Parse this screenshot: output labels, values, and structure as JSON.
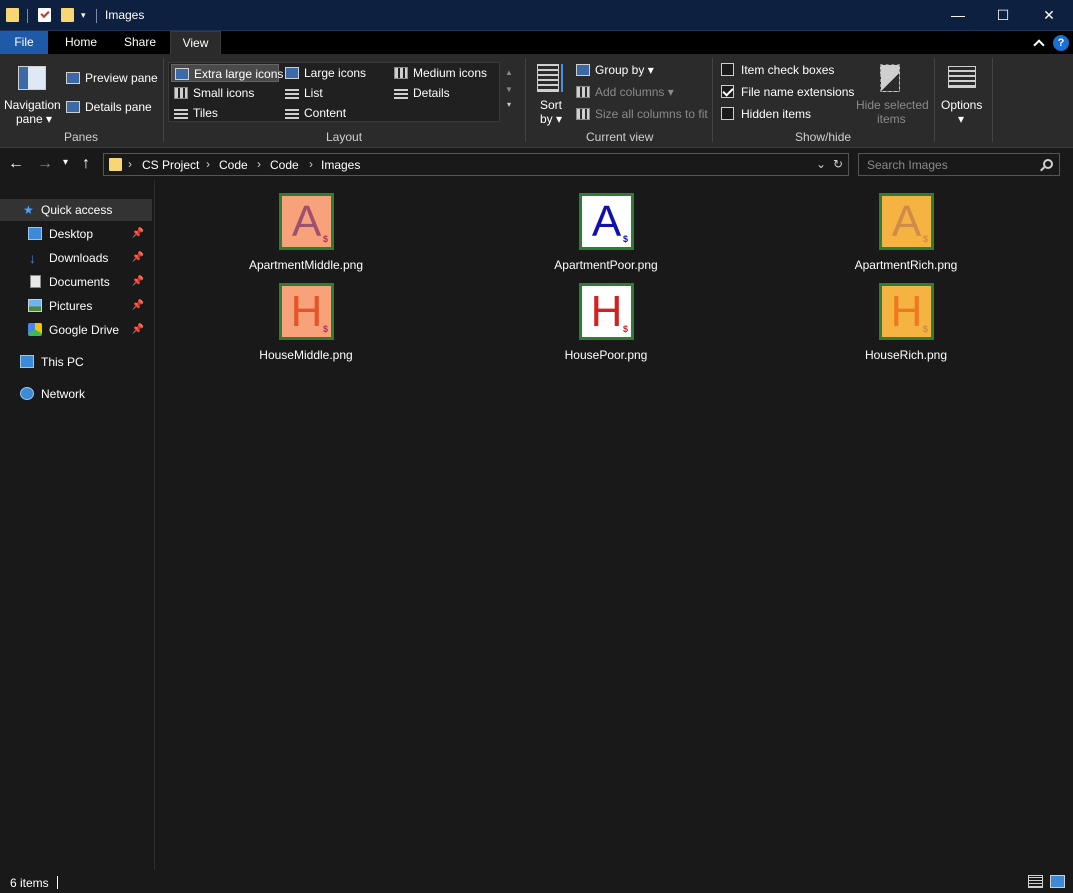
{
  "window": {
    "title": "Images"
  },
  "window_controls": {
    "minimize": "—",
    "maximize": "☐",
    "close": "✕"
  },
  "ribbon_tabs": [
    {
      "label": "File"
    },
    {
      "label": "Home"
    },
    {
      "label": "Share"
    },
    {
      "label": "View"
    }
  ],
  "help": {
    "label": "?"
  },
  "panes": {
    "navigation_pane": "Navigation",
    "navigation_pane_line2": "pane",
    "preview_pane": "Preview pane",
    "details_pane": "Details pane",
    "group_label": "Panes"
  },
  "layout": {
    "options": [
      {
        "label": "Extra large icons",
        "selected": true
      },
      {
        "label": "Large icons"
      },
      {
        "label": "Medium icons"
      },
      {
        "label": "Small icons"
      },
      {
        "label": "List"
      },
      {
        "label": "Details"
      },
      {
        "label": "Tiles"
      },
      {
        "label": "Content"
      }
    ],
    "group_label": "Layout"
  },
  "current_view": {
    "sort_by": "Sort",
    "sort_by_line2": "by",
    "group_by": "Group by",
    "add_columns": "Add columns",
    "size_columns": "Size all columns to fit",
    "group_label": "Current view"
  },
  "show_hide": {
    "item_check_boxes": {
      "label": "Item check boxes",
      "checked": false
    },
    "file_name_extensions": {
      "label": "File name extensions",
      "checked": true
    },
    "hidden_items": {
      "label": "Hidden items",
      "checked": false
    },
    "hide_selected": "Hide selected",
    "hide_selected_line2": "items",
    "group_label": "Show/hide"
  },
  "options": {
    "label": "Options"
  },
  "address": {
    "breadcrumbs": [
      "CS Project",
      "Code",
      "Code",
      "Images"
    ],
    "search_placeholder": "Search Images"
  },
  "nav_pane": {
    "quick_access": "Quick access",
    "items": [
      {
        "label": "Desktop",
        "pinned": true
      },
      {
        "label": "Downloads",
        "pinned": true
      },
      {
        "label": "Documents",
        "pinned": true
      },
      {
        "label": "Pictures",
        "pinned": true
      },
      {
        "label": "Google Drive",
        "pinned": true
      }
    ],
    "this_pc": "This PC",
    "network": "Network"
  },
  "files": [
    {
      "name": "ApartmentMiddle.png",
      "letter": "A",
      "bg": "#f7a27a",
      "fg": "#a0506e",
      "dollar": "#b03060"
    },
    {
      "name": "ApartmentPoor.png",
      "letter": "A",
      "bg": "#ffffff",
      "fg": "#1010b0",
      "dollar": "#1010b0"
    },
    {
      "name": "ApartmentRich.png",
      "letter": "A",
      "bg": "#f5b342",
      "fg": "#d08a4a",
      "dollar": "#d08a4a"
    },
    {
      "name": "HouseMiddle.png",
      "letter": "H",
      "bg": "#f7a27a",
      "fg": "#e8542a",
      "dollar": "#b03060"
    },
    {
      "name": "HousePoor.png",
      "letter": "H",
      "bg": "#ffffff",
      "fg": "#d42020",
      "dollar": "#d42020"
    },
    {
      "name": "HouseRich.png",
      "letter": "H",
      "bg": "#f5b342",
      "fg": "#f07820",
      "dollar": "#d08a4a"
    }
  ],
  "status": {
    "item_count": "6 items"
  }
}
